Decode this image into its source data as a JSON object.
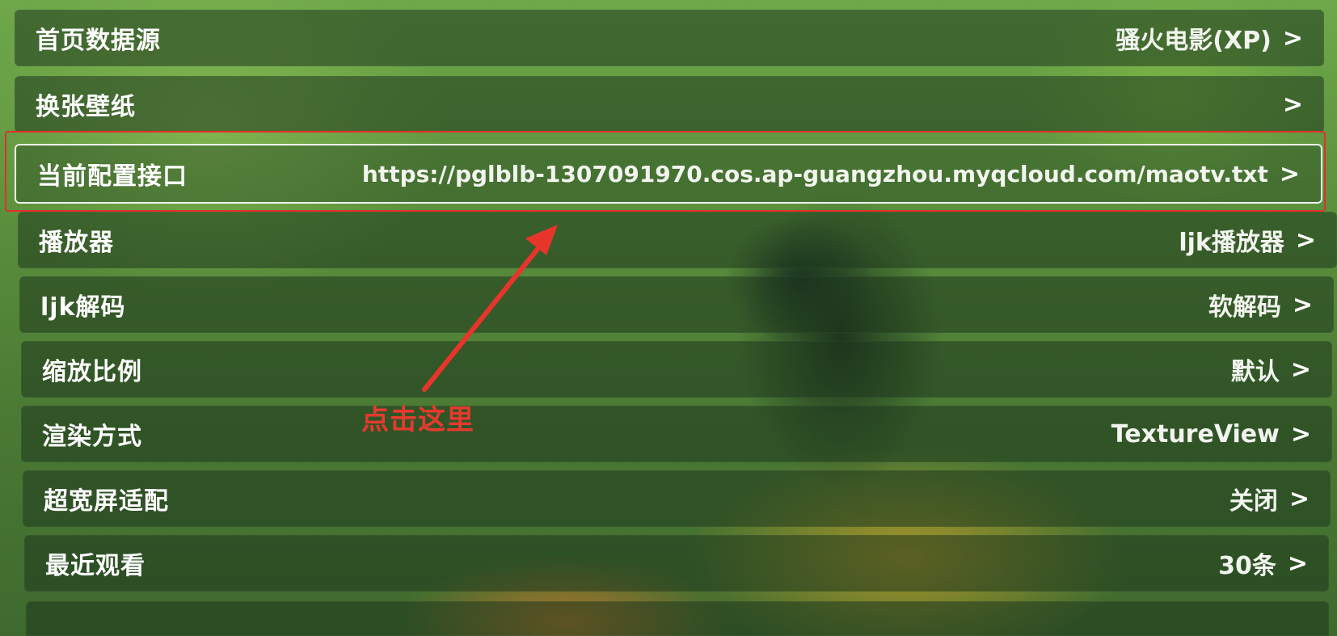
{
  "settings": {
    "items": [
      {
        "label": "首页数据源",
        "value": "骚火电影(XP)"
      },
      {
        "label": "换张壁纸",
        "value": ""
      },
      {
        "label": "当前配置接口",
        "value": "https://pglblb-1307091970.cos.ap-guangzhou.myqcloud.com/maotv.txt"
      },
      {
        "label": "播放器",
        "value": "ljk播放器"
      },
      {
        "label": "ljk解码",
        "value": "软解码"
      },
      {
        "label": "缩放比例",
        "value": "默认"
      },
      {
        "label": "渲染方式",
        "value": "TextureView"
      },
      {
        "label": "超宽屏适配",
        "value": "关闭"
      },
      {
        "label": "最近观看",
        "value": "30条"
      }
    ],
    "chevron": ">"
  },
  "annotation": {
    "text": "点击这里",
    "color": "#e63a2e"
  },
  "icons": {
    "chevron": "chevron-right-icon",
    "arrow": "red-arrow-annotation"
  }
}
